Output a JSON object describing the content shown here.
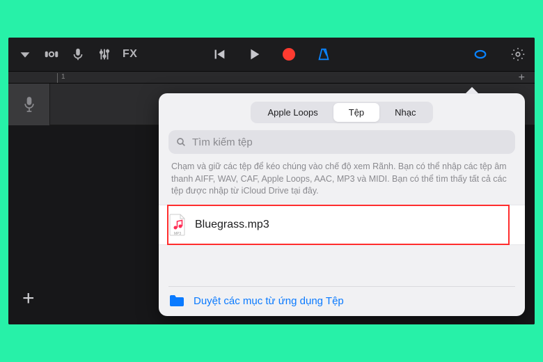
{
  "toolbar": {
    "fx_label": "FX"
  },
  "popover": {
    "tabs": [
      {
        "label": "Apple Loops",
        "active": false
      },
      {
        "label": "Tệp",
        "active": true
      },
      {
        "label": "Nhạc",
        "active": false
      }
    ],
    "search_placeholder": "Tìm kiếm tệp",
    "hint": "Chạm và giữ các tệp để kéo chúng vào chế độ xem Rãnh. Bạn có thể nhập các tệp âm thanh AIFF, WAV, CAF, Apple Loops, AAC, MP3 và MIDI. Bạn có thể tìm thấy tất cả các tệp được nhập từ iCloud Drive tại đây.",
    "file_name": "Bluegrass.mp3",
    "browse_label": "Duyệt các mục từ ứng dụng Tệp"
  }
}
